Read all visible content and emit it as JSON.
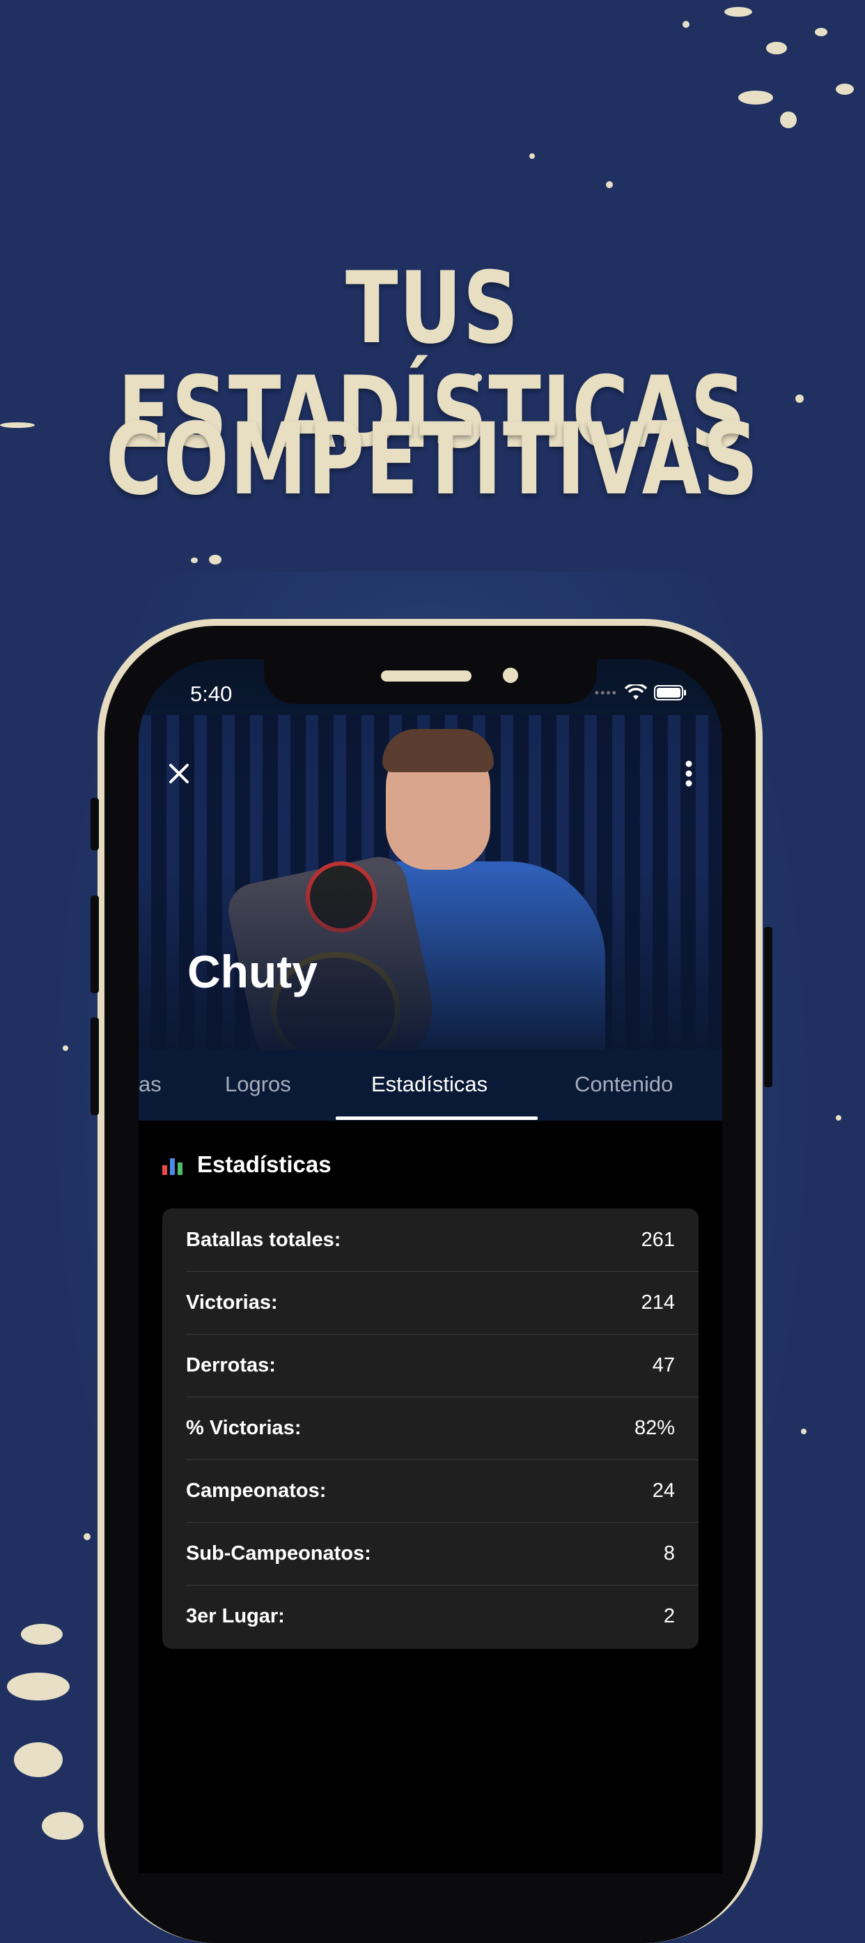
{
  "headline": {
    "line1": "TUS ESTADÍSTICAS",
    "line2": "COMPETITIVAS"
  },
  "status_bar": {
    "time": "5:40",
    "icons": [
      "signal-icon",
      "wifi-icon",
      "battery-icon"
    ]
  },
  "profile": {
    "name": "Chuty",
    "close_icon": "close-icon",
    "more_icon": "more-vertical-icon"
  },
  "tabs": [
    {
      "label": "as",
      "active": false
    },
    {
      "label": "Logros",
      "active": false
    },
    {
      "label": "Estadísticas",
      "active": true
    },
    {
      "label": "Contenido",
      "active": false
    }
  ],
  "stats_section": {
    "icon": "bar-chart-icon",
    "title": "Estadísticas",
    "rows": [
      {
        "label": "Batallas totales:",
        "value": "261"
      },
      {
        "label": "Victorias:",
        "value": "214"
      },
      {
        "label": "Derrotas:",
        "value": "47"
      },
      {
        "label": "% Victorias:",
        "value": "82%"
      },
      {
        "label": "Campeonatos:",
        "value": "24"
      },
      {
        "label": "Sub-Campeonatos:",
        "value": "8"
      },
      {
        "label": "3er Lugar:",
        "value": "2"
      }
    ]
  },
  "colors": {
    "background": "#1f3061",
    "headline": "#e8dfc3",
    "phone_frame": "#e6dcc0",
    "card": "#1f1f1f",
    "tab_bar": "#0a1a36"
  }
}
